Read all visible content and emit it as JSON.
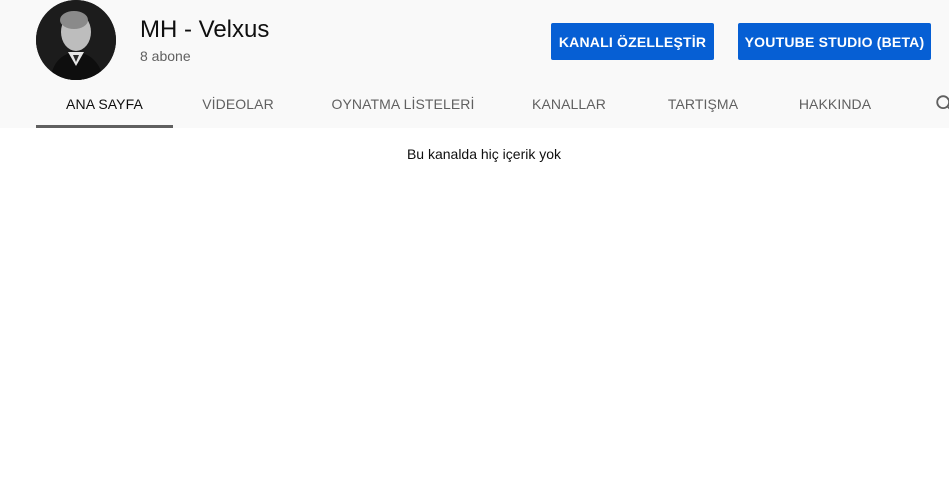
{
  "channel": {
    "name": "MH - Velxus",
    "subscribers": "8 abone"
  },
  "buttons": {
    "customize": "KANALI ÖZELLEŞTİR",
    "studio": "YOUTUBE STUDIO (BETA)"
  },
  "tabs": [
    {
      "label": "ANA SAYFA",
      "active": true
    },
    {
      "label": "VİDEOLAR",
      "active": false
    },
    {
      "label": "OYNATMA LİSTELERİ",
      "active": false
    },
    {
      "label": "KANALLAR",
      "active": false
    },
    {
      "label": "TARTIŞMA",
      "active": false
    },
    {
      "label": "HAKKINDA",
      "active": false
    }
  ],
  "content": {
    "empty_message": "Bu kanalda hiç içerik yok"
  },
  "icons": {
    "search": "search-icon"
  },
  "colors": {
    "accent": "#065fd4",
    "header_bg": "#f9f9f9",
    "tab_inactive": "#606060",
    "tab_active": "#0f0f0f"
  }
}
